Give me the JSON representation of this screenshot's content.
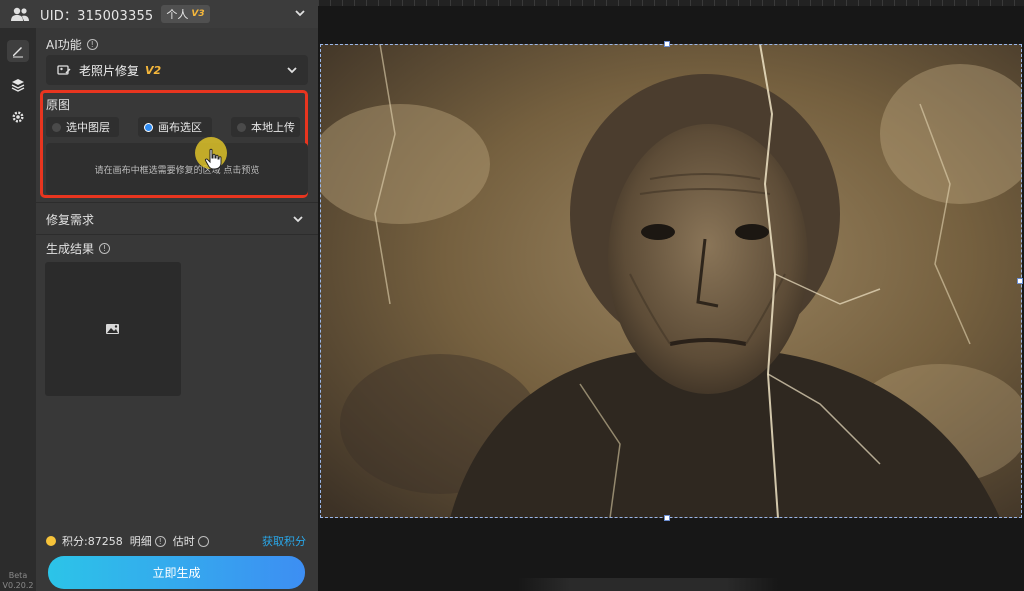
{
  "header": {
    "uid": "UID：315003355",
    "tier_label": "个人",
    "tier_badge": "V3"
  },
  "rail": {
    "items": [
      "edit-icon",
      "layers-icon",
      "gear-icon"
    ],
    "beta_label": "Beta",
    "version": "V0.20.2"
  },
  "ai": {
    "section_label": "AI功能",
    "selected_function": "老照片修复",
    "function_version": "V2"
  },
  "source": {
    "section_label": "原图",
    "options": [
      {
        "label": "选中图层",
        "selected": false
      },
      {
        "label": "画布选区",
        "selected": true
      },
      {
        "label": "本地上传",
        "selected": false
      }
    ],
    "hint": "请在画布中框选需要修复的区域 点击预览"
  },
  "repair": {
    "section_label": "修复需求"
  },
  "result": {
    "section_label": "生成结果"
  },
  "footer": {
    "points_label": "积分:87258",
    "detail_label": "明细",
    "estimate_label": "估时",
    "get_points_label": "获取积分",
    "generate_label": "立即生成"
  },
  "colors": {
    "accent": "#2f8cf3",
    "highlight_border": "#e8351f",
    "gold": "#f5b73b",
    "link": "#29a7e9",
    "button_gradient_start": "#2cc4e8",
    "button_gradient_end": "#3d8ef3"
  },
  "canvas": {
    "image_description_icon": "old-photo-image"
  }
}
